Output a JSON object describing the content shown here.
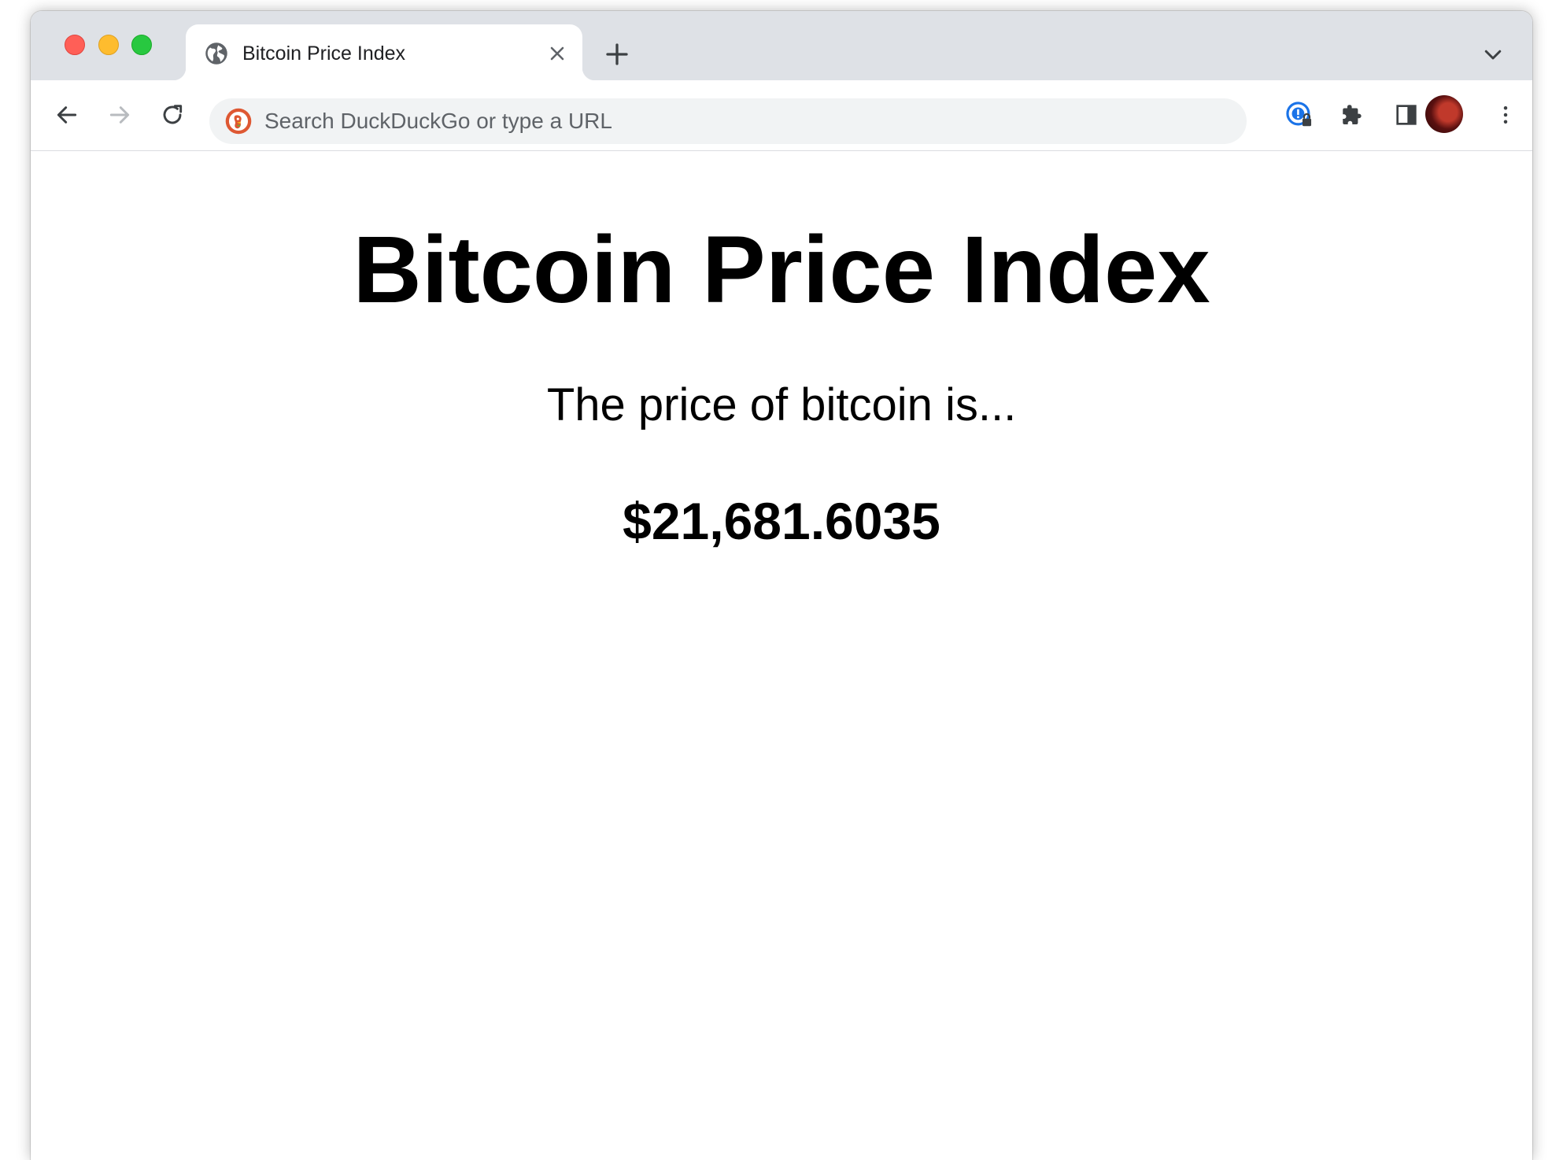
{
  "browser": {
    "tab": {
      "title": "Bitcoin Price Index"
    },
    "omnibox": {
      "placeholder": "Search DuckDuckGo or type a URL",
      "value": ""
    },
    "colors": {
      "tabstrip": "#dee1e6",
      "omnibox": "#f1f3f4",
      "close_red": "#ff5f57",
      "minimize_yellow": "#febc2e",
      "zoom_green": "#28c840"
    },
    "icons": {
      "tab_favicon": "globe-icon",
      "new_tab": "plus-icon",
      "tab_search": "chevron-down-icon",
      "back": "arrow-left-icon",
      "forward": "arrow-right-icon",
      "reload": "reload-icon",
      "search_engine": "duckduckgo-icon",
      "password_manager": "password-lock-icon",
      "extensions": "puzzle-icon",
      "side_panel": "side-panel-icon",
      "profile": "avatar",
      "menu": "kebab-menu-icon"
    }
  },
  "page": {
    "heading": "Bitcoin Price Index",
    "subheading": "The price of bitcoin is...",
    "price": "$21,681.6035"
  }
}
